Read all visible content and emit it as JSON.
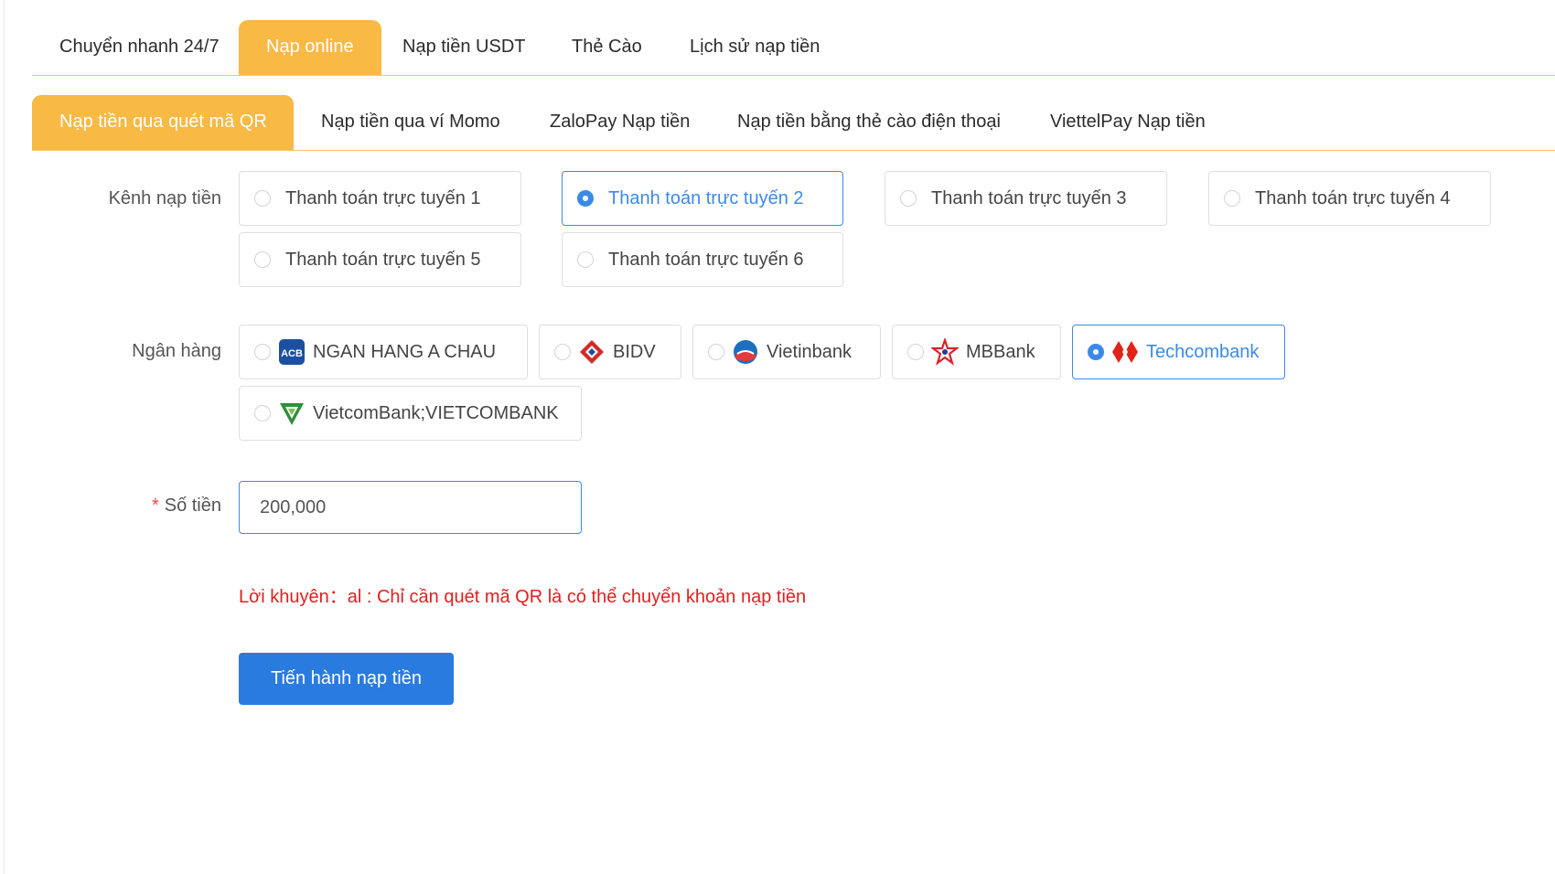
{
  "top_tabs": [
    {
      "label": "Chuyển nhanh 24/7",
      "active": false
    },
    {
      "label": "Nạp online",
      "active": true
    },
    {
      "label": "Nạp tiền USDT",
      "active": false
    },
    {
      "label": "Thẻ Cào",
      "active": false
    },
    {
      "label": "Lịch sử nạp tiền",
      "active": false
    }
  ],
  "sub_tabs": [
    {
      "label": "Nạp tiền qua quét mã QR",
      "active": true
    },
    {
      "label": "Nạp tiền qua ví Momo",
      "active": false
    },
    {
      "label": "ZaloPay Nạp tiền",
      "active": false
    },
    {
      "label": "Nạp tiền bằng thẻ cào điện thoại",
      "active": false
    },
    {
      "label": "ViettelPay Nạp tiền",
      "active": false
    }
  ],
  "channel": {
    "label": "Kênh nạp tiền",
    "options": [
      {
        "label": "Thanh toán trực tuyến 1",
        "selected": false
      },
      {
        "label": "Thanh toán trực tuyến 2",
        "selected": true
      },
      {
        "label": "Thanh toán trực tuyến 3",
        "selected": false
      },
      {
        "label": "Thanh toán trực tuyến 4",
        "selected": false
      },
      {
        "label": "Thanh toán trực tuyến 5",
        "selected": false
      },
      {
        "label": "Thanh toán trực tuyến 6",
        "selected": false
      }
    ]
  },
  "bank": {
    "label": "Ngân hàng",
    "options": [
      {
        "label": "NGAN HANG A CHAU",
        "icon": "acb-logo-icon",
        "logo_text": "ACB",
        "selected": false
      },
      {
        "label": "BIDV",
        "icon": "bidv-logo-icon",
        "selected": false
      },
      {
        "label": "Vietinbank",
        "icon": "vietinbank-logo-icon",
        "selected": false
      },
      {
        "label": "MBBank",
        "icon": "mbbank-logo-icon",
        "selected": false
      },
      {
        "label": "Techcombank",
        "icon": "techcombank-logo-icon",
        "selected": true
      },
      {
        "label": "VietcomBank;VIETCOMBANK",
        "icon": "vietcombank-logo-icon",
        "selected": false
      }
    ]
  },
  "amount": {
    "required_mark": "*",
    "label": "Số tiền",
    "value": "200,000"
  },
  "advice": "Lời khuyên：al : Chỉ cần quét mã QR là có thể chuyển khoản nạp tiền",
  "submit_label": "Tiến hành nạp tiền",
  "colors": {
    "accent": "#f8b945",
    "primary": "#2a7be0",
    "selected": "#3c8ae8",
    "warning_text": "#e02020"
  }
}
